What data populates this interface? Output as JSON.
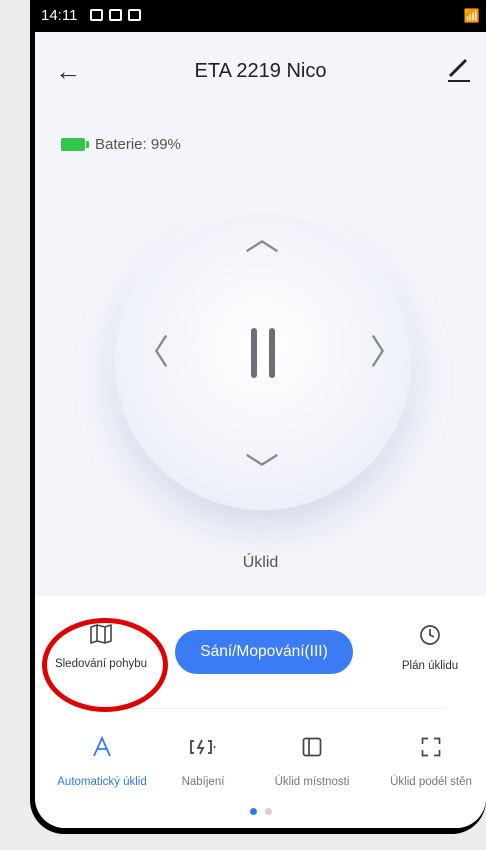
{
  "status_bar": {
    "time": "14:11"
  },
  "header": {
    "title": "ETA 2219 Nico",
    "back_icon": "arrow-left-icon",
    "edit_icon": "pencil-icon"
  },
  "battery": {
    "label": "Baterie: 99%",
    "level_percent": 99,
    "color": "#2fc64a"
  },
  "control": {
    "mode_label": "Úklid",
    "center_icon": "pause-icon"
  },
  "actions": {
    "track_label": "Sledování pohybu",
    "suction_button": "Sání/Mopování(III)",
    "schedule_label": "Plán úklidu"
  },
  "tabs": [
    {
      "label": "Automatický úklid",
      "icon": "letter-a-icon",
      "active": true
    },
    {
      "label": "Nabíjení",
      "icon": "charging-icon",
      "active": false
    },
    {
      "label": "Úklid místnosti",
      "icon": "room-icon",
      "active": false
    },
    {
      "label": "Úklid podél stěn",
      "icon": "edge-icon",
      "active": false
    }
  ],
  "pager": {
    "pages": 2,
    "current": 1
  },
  "colors": {
    "accent": "#3b7bf6",
    "highlight": "#e00000"
  }
}
